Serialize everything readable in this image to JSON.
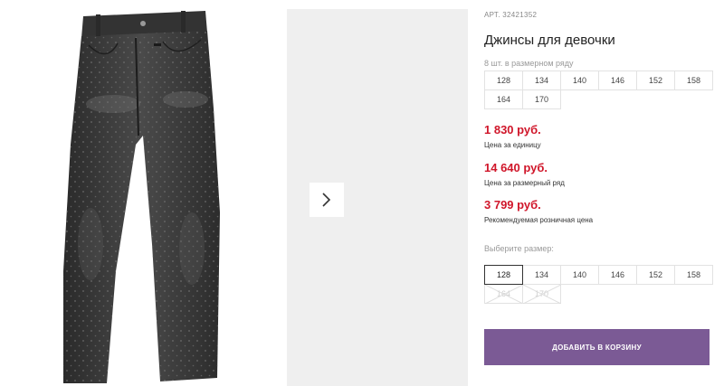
{
  "product": {
    "article_label": "АРТ.",
    "article_number": "32421352",
    "title": "Джинсы для девочки",
    "image_icon": "jeans-photo"
  },
  "gallery": {
    "next_icon": "chevron-right-icon"
  },
  "pack": {
    "label": "8 шт. в размерном ряду",
    "sizes": [
      "128",
      "134",
      "140",
      "146",
      "152",
      "158",
      "164",
      "170"
    ]
  },
  "prices": [
    {
      "value": "1 830 руб.",
      "caption": "Цена за единицу"
    },
    {
      "value": "14 640 руб.",
      "caption": "Цена за размерный ряд"
    },
    {
      "value": "3 799 руб.",
      "caption": "Рекомендуемая розничная цена"
    }
  ],
  "size_select": {
    "label": "Выберите размер:",
    "selected": "128",
    "sizes": [
      "128",
      "134",
      "140",
      "146",
      "152",
      "158"
    ],
    "unavailable": [
      "164",
      "170"
    ]
  },
  "cart": {
    "add_label": "ДОБАВИТЬ В КОРЗИНУ"
  },
  "colors": {
    "price": "#d0162a",
    "button": "#7b5a95",
    "gallery_bg": "#efefef"
  }
}
